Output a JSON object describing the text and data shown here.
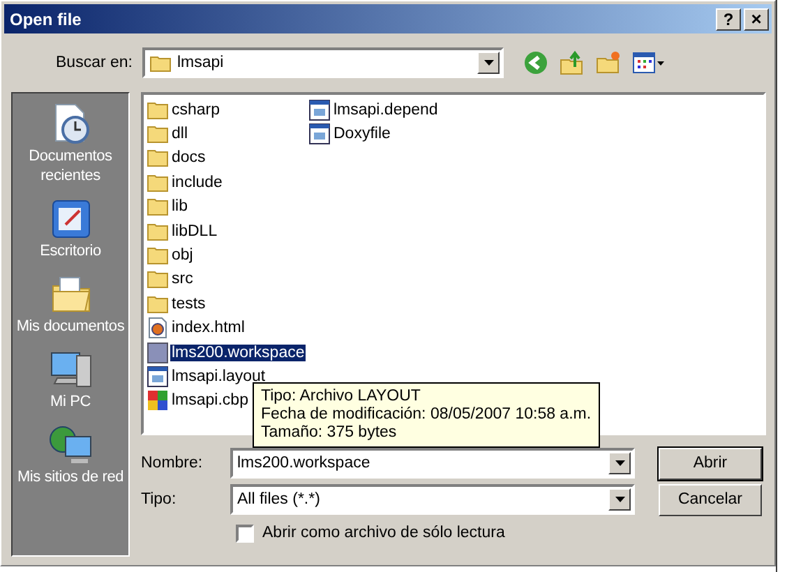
{
  "window": {
    "title": "Open file",
    "buttons": [
      {
        "kind": "help",
        "label": "?"
      },
      {
        "kind": "close",
        "label": "×"
      }
    ]
  },
  "look_in": {
    "label": "Buscar en:",
    "value": "lmsapi"
  },
  "places": [
    {
      "kind": "recent",
      "label": "Documentos recientes"
    },
    {
      "kind": "desktop",
      "label": "Escritorio"
    },
    {
      "kind": "documents",
      "label": "Mis documentos"
    },
    {
      "kind": "computer",
      "label": "Mi PC"
    },
    {
      "kind": "network",
      "label": "Mis sitios de red"
    }
  ],
  "files": [
    {
      "kind": "folder",
      "name": "csharp",
      "selected": false
    },
    {
      "kind": "folder",
      "name": "dll",
      "selected": false
    },
    {
      "kind": "folder",
      "name": "docs",
      "selected": false
    },
    {
      "kind": "folder",
      "name": "include",
      "selected": false
    },
    {
      "kind": "folder",
      "name": "lib",
      "selected": false
    },
    {
      "kind": "folder",
      "name": "libDLL",
      "selected": false
    },
    {
      "kind": "folder",
      "name": "obj",
      "selected": false
    },
    {
      "kind": "folder",
      "name": "src",
      "selected": false
    },
    {
      "kind": "folder",
      "name": "tests",
      "selected": false
    },
    {
      "kind": "html",
      "name": "index.html",
      "selected": false
    },
    {
      "kind": "workspace",
      "name": "lms200.workspace",
      "selected": true
    },
    {
      "kind": "document",
      "name": "lmsapi.layout",
      "selected": false
    },
    {
      "kind": "project",
      "name": "lmsapi.cbp",
      "selected": false
    },
    {
      "kind": "document",
      "name": "lmsapi.depend",
      "selected": false
    },
    {
      "kind": "document",
      "name": "Doxyfile",
      "selected": false
    }
  ],
  "tooltip": [
    "Tipo: Archivo LAYOUT",
    "Fecha de modificación: 08/05/2007 10:58 a.m.",
    "Tamaño: 375 bytes"
  ],
  "file_name": {
    "label": "Nombre:",
    "value": "lms200.workspace"
  },
  "file_type": {
    "label": "Tipo:",
    "value": "All files (*.*)"
  },
  "read_only": {
    "label": "Abrir como archivo de sólo lectura",
    "checked": false
  },
  "buttons": [
    "Abrir",
    "Cancelar"
  ]
}
